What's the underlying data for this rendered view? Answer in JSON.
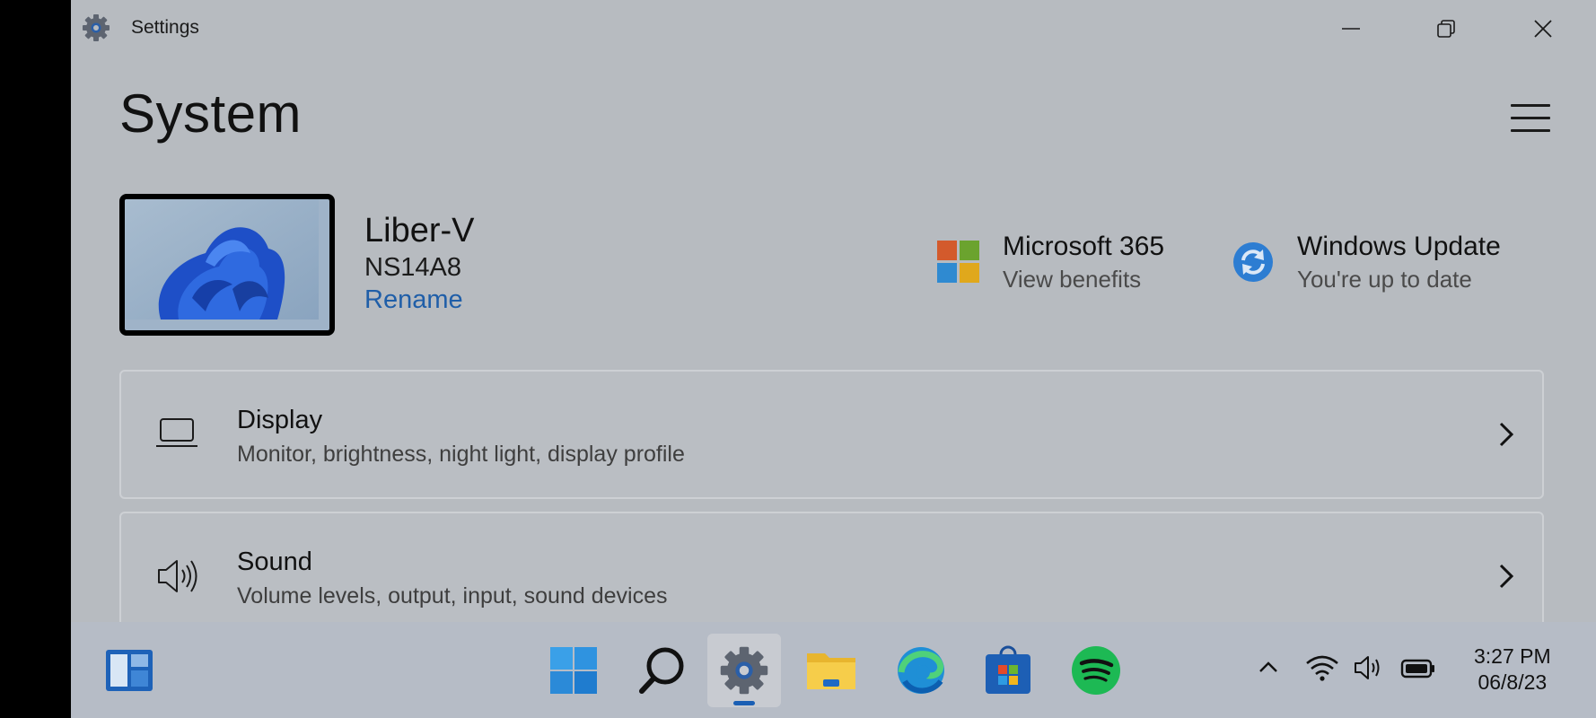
{
  "window": {
    "title": "Settings",
    "icon": "gear-icon"
  },
  "page": {
    "title": "System"
  },
  "device": {
    "name": "Liber-V",
    "model": "NS14A8",
    "rename_label": "Rename"
  },
  "quick_links": [
    {
      "title": "Microsoft 365",
      "subtitle": "View benefits",
      "icon": "microsoft-365-icon"
    },
    {
      "title": "Windows Update",
      "subtitle": "You're up to date",
      "icon": "windows-update-icon"
    }
  ],
  "settings_items": [
    {
      "title": "Display",
      "subtitle": "Monitor, brightness, night light, display profile",
      "icon": "laptop-icon"
    },
    {
      "title": "Sound",
      "subtitle": "Volume levels, output, input, sound devices",
      "icon": "speaker-icon"
    }
  ],
  "taskbar": {
    "apps": [
      "widgets",
      "start",
      "search",
      "settings",
      "file-explorer",
      "edge",
      "microsoft-store",
      "spotify"
    ],
    "active_app": "settings",
    "clock": {
      "time": "3:27 PM",
      "date": "06/8/23"
    }
  },
  "colors": {
    "accent": "#1f5ea8",
    "window_bg": "#b7bbc0",
    "taskbar_bg": "#b6bcc6"
  }
}
